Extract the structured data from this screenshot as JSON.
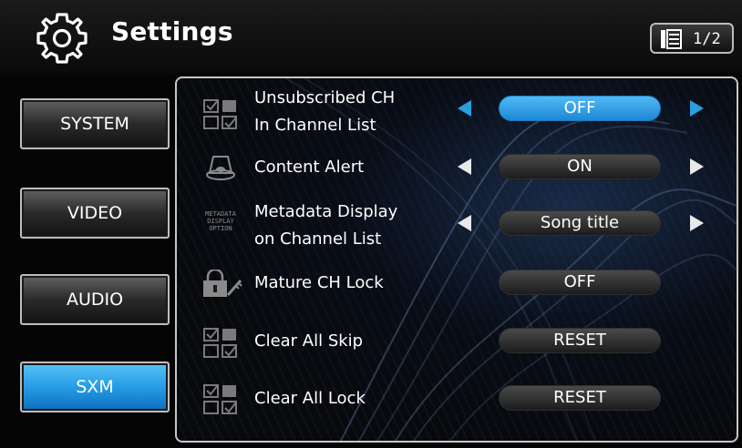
{
  "header": {
    "title": "Settings",
    "page_indicator": "1/2"
  },
  "tabs": [
    {
      "label": "SYSTEM",
      "active": false
    },
    {
      "label": "VIDEO",
      "active": false
    },
    {
      "label": "AUDIO",
      "active": false
    },
    {
      "label": "SXM",
      "active": true
    }
  ],
  "settings": [
    {
      "label_line1": "Unsubscribed CH",
      "label_line2": "In Channel List",
      "value": "OFF",
      "icon": "checkbox-grid-icon",
      "has_arrows": true,
      "selected": true
    },
    {
      "label_line1": "Content Alert",
      "value": "ON",
      "icon": "bell-icon",
      "has_arrows": true,
      "selected": false
    },
    {
      "label_line1": "Metadata Display",
      "label_line2": "on Channel List",
      "value": "Song title",
      "icon": "metadata-display-option-icon",
      "icon_text": [
        "METADATA",
        "DISPLAY",
        "OPTION"
      ],
      "has_arrows": true,
      "selected": false
    },
    {
      "label_line1": "Mature CH Lock",
      "value": "OFF",
      "icon": "lock-key-icon",
      "has_arrows": false,
      "selected": false
    },
    {
      "label_line1": "Clear All Skip",
      "value": "RESET",
      "icon": "checkbox-grid-icon",
      "has_arrows": false,
      "selected": false
    },
    {
      "label_line1": "Clear All Lock",
      "value": "RESET",
      "icon": "checkbox-grid-icon",
      "has_arrows": false,
      "selected": false
    }
  ],
  "colors": {
    "accent": "#2aa0e8",
    "arrow_active": "#27a0e0",
    "arrow_inactive": "#e8e8e8"
  }
}
